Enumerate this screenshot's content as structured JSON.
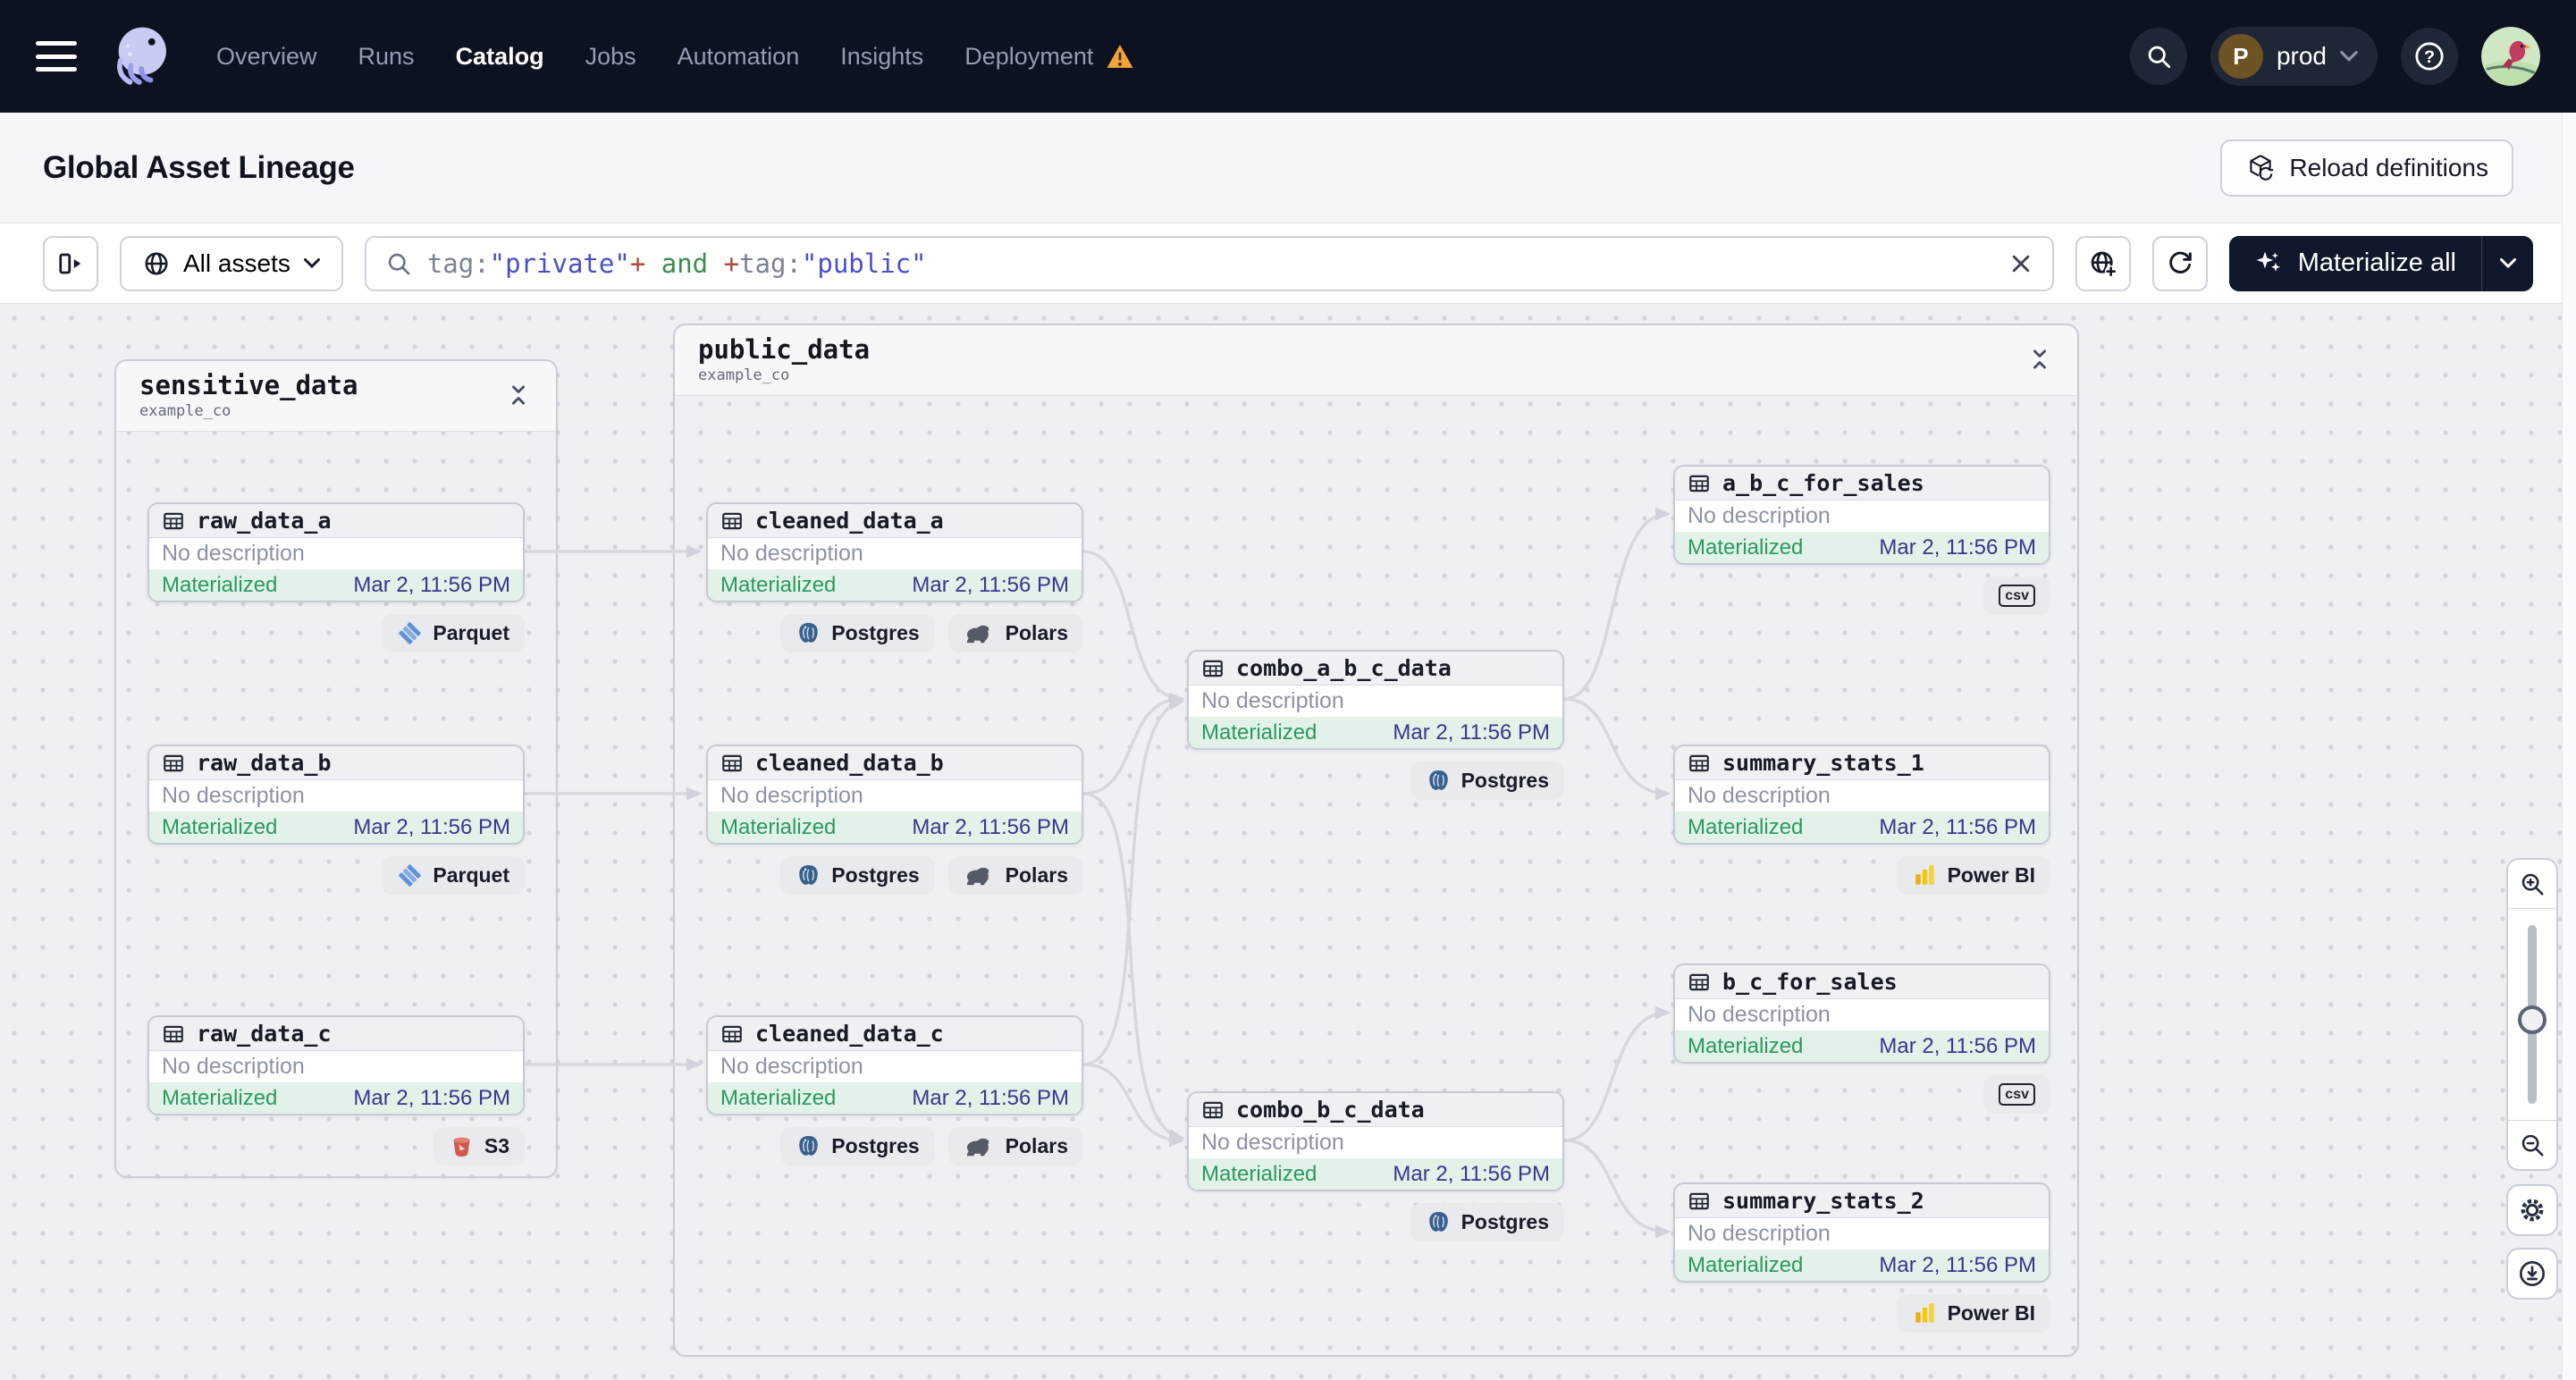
{
  "nav": {
    "items": [
      {
        "label": "Overview",
        "active": false
      },
      {
        "label": "Runs",
        "active": false
      },
      {
        "label": "Catalog",
        "active": true
      },
      {
        "label": "Jobs",
        "active": false
      },
      {
        "label": "Automation",
        "active": false
      },
      {
        "label": "Insights",
        "active": false
      },
      {
        "label": "Deployment",
        "active": false,
        "warning": true
      }
    ],
    "environment": {
      "initial": "P",
      "name": "prod"
    }
  },
  "page": {
    "title": "Global Asset Lineage",
    "reload_button": "Reload definitions"
  },
  "filterbar": {
    "scope_button": "All assets",
    "query_segments": [
      {
        "text": "tag:"
      },
      {
        "text": "\"private\""
      },
      {
        "text": "+"
      },
      {
        "text": " and "
      },
      {
        "text": "+"
      },
      {
        "text": "tag:"
      },
      {
        "text": "\"public\""
      }
    ],
    "materialize_button": "Materialize all"
  },
  "graph": {
    "groups": [
      {
        "name": "sensitive_data",
        "location": "example_co"
      },
      {
        "name": "public_data",
        "location": "example_co"
      }
    ],
    "nodes": [
      {
        "name": "raw_data_a",
        "description": "No description",
        "status": "Materialized",
        "timestamp": "Mar 2, 11:56 PM",
        "badges": [
          {
            "label": "Parquet",
            "icon": "parquet"
          }
        ]
      },
      {
        "name": "raw_data_b",
        "description": "No description",
        "status": "Materialized",
        "timestamp": "Mar 2, 11:56 PM",
        "badges": [
          {
            "label": "Parquet",
            "icon": "parquet"
          }
        ]
      },
      {
        "name": "raw_data_c",
        "description": "No description",
        "status": "Materialized",
        "timestamp": "Mar 2, 11:56 PM",
        "badges": [
          {
            "label": "S3",
            "icon": "s3"
          }
        ]
      },
      {
        "name": "cleaned_data_a",
        "description": "No description",
        "status": "Materialized",
        "timestamp": "Mar 2, 11:56 PM",
        "badges": [
          {
            "label": "Postgres",
            "icon": "postgres"
          },
          {
            "label": "Polars",
            "icon": "polars"
          }
        ]
      },
      {
        "name": "cleaned_data_b",
        "description": "No description",
        "status": "Materialized",
        "timestamp": "Mar 2, 11:56 PM",
        "badges": [
          {
            "label": "Postgres",
            "icon": "postgres"
          },
          {
            "label": "Polars",
            "icon": "polars"
          }
        ]
      },
      {
        "name": "cleaned_data_c",
        "description": "No description",
        "status": "Materialized",
        "timestamp": "Mar 2, 11:56 PM",
        "badges": [
          {
            "label": "Postgres",
            "icon": "postgres"
          },
          {
            "label": "Polars",
            "icon": "polars"
          }
        ]
      },
      {
        "name": "combo_a_b_c_data",
        "description": "No description",
        "status": "Materialized",
        "timestamp": "Mar 2, 11:56 PM",
        "badges": [
          {
            "label": "Postgres",
            "icon": "postgres"
          }
        ]
      },
      {
        "name": "combo_b_c_data",
        "description": "No description",
        "status": "Materialized",
        "timestamp": "Mar 2, 11:56 PM",
        "badges": [
          {
            "label": "Postgres",
            "icon": "postgres"
          }
        ]
      },
      {
        "name": "a_b_c_for_sales",
        "description": "No description",
        "status": "Materialized",
        "timestamp": "Mar 2, 11:56 PM",
        "badges": [
          {
            "label": "csv",
            "icon": "csv"
          }
        ]
      },
      {
        "name": "summary_stats_1",
        "description": "No description",
        "status": "Materialized",
        "timestamp": "Mar 2, 11:56 PM",
        "badges": [
          {
            "label": "Power BI",
            "icon": "powerbi"
          }
        ]
      },
      {
        "name": "b_c_for_sales",
        "description": "No description",
        "status": "Materialized",
        "timestamp": "Mar 2, 11:56 PM",
        "badges": [
          {
            "label": "csv",
            "icon": "csv"
          }
        ]
      },
      {
        "name": "summary_stats_2",
        "description": "No description",
        "status": "Materialized",
        "timestamp": "Mar 2, 11:56 PM",
        "badges": [
          {
            "label": "Power BI",
            "icon": "powerbi"
          }
        ]
      }
    ]
  },
  "colors": {
    "nav_bg": "#0d1221",
    "materialized_green": "#2b9a5e",
    "status_bg_green": "#e2f2e8",
    "timestamp_indigo": "#37378f",
    "warning_orange": "#f2a33c",
    "query_string": "#4a4fc9",
    "query_operator": "#b04a3e",
    "query_keyword": "#3d8b50",
    "edge_gray": "#d6d8e0"
  }
}
